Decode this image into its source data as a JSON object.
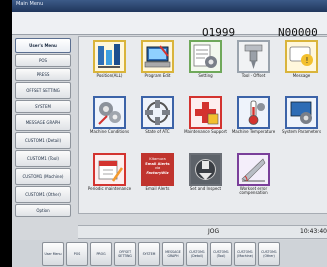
{
  "window": {
    "title": "Main Menu"
  },
  "header": {
    "program_number": "O1999",
    "sequence_number": "N00000"
  },
  "left_menu": [
    "User's Menu",
    "POS",
    "PRESS",
    "OFFSET SETTING",
    "SYSTEM",
    "MESSAGE GRAPH",
    "CUSTOM1 (Detail)",
    "CUSTOM1 (Tool)",
    "CUSTOM1 (Machine)",
    "CUSTOM1 (Other)",
    "Option"
  ],
  "tiles": [
    {
      "label": "Position(ALL)",
      "icon": "position-icon"
    },
    {
      "label": "Program Edit",
      "icon": "program-edit-icon"
    },
    {
      "label": "Setting",
      "icon": "setting-icon"
    },
    {
      "label": "Tool · Offset",
      "icon": "tool-offset-icon"
    },
    {
      "label": "Message",
      "icon": "message-icon"
    },
    {
      "label": "Machine Conditions",
      "icon": "machine-conditions-icon"
    },
    {
      "label": "State of ATC",
      "icon": "atc-icon"
    },
    {
      "label": "Maintenance Support",
      "icon": "maintenance-icon"
    },
    {
      "label": "Machine Temperature",
      "icon": "temperature-icon"
    },
    {
      "label": "System Parameters",
      "icon": "system-icon"
    },
    {
      "label": "Periodic maintenance",
      "icon": "periodic-icon"
    },
    {
      "label": "Email Alerts",
      "icon": "email-alerts-icon",
      "promo": [
        "Kitamura",
        "Email Alerts",
        "via",
        "FactoryWiz"
      ]
    },
    {
      "label": "Set and Inspect",
      "icon": "set-inspect-icon"
    },
    {
      "label": "Workset error compensation",
      "icon": "compensation-icon"
    }
  ],
  "status": {
    "mode": "JOG",
    "time": "10:43:40"
  },
  "function_keys": [
    "User Menu",
    "POS",
    "PROG",
    "OFFSET SETTING",
    "SYSTEM",
    "MESSAGE GRAPH",
    "CUSTOM1 (Detail)",
    "CUSTOM1 (Tool)",
    "CUSTOM1 (Machine)",
    "CUSTOM1 (Other)"
  ],
  "colors": {
    "title_bar": "#2c4a78",
    "accent_red": "#d3332f",
    "accent_blue": "#2f6fb6",
    "promo_bg": "#c0342e"
  }
}
